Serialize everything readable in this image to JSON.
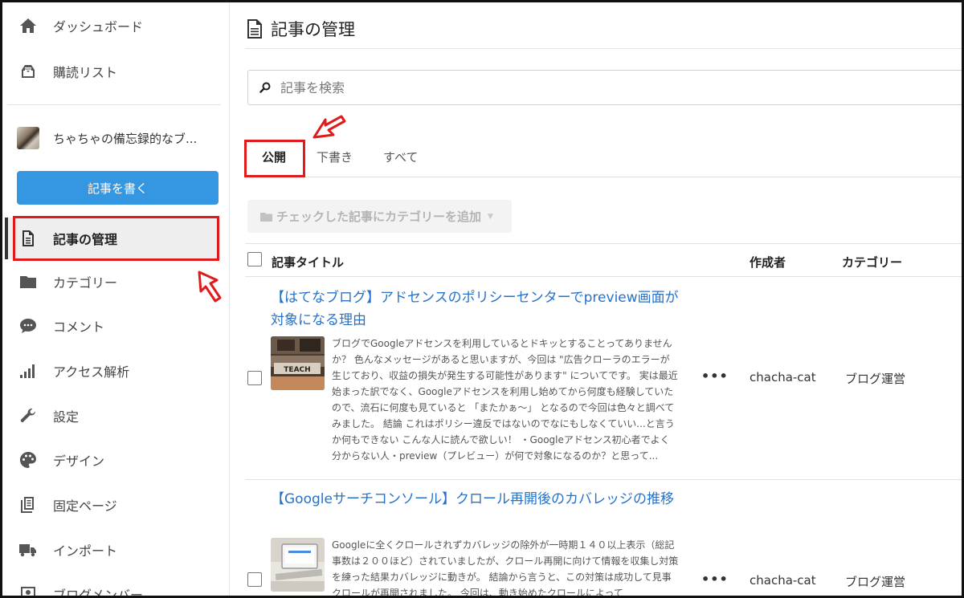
{
  "sidebar": {
    "items": [
      {
        "label": "ダッシュボード",
        "icon": "home-icon"
      },
      {
        "label": "購読リスト",
        "icon": "inbox-icon"
      },
      {
        "label": "記事の管理",
        "icon": "document-icon"
      },
      {
        "label": "カテゴリー",
        "icon": "folder-icon"
      },
      {
        "label": "コメント",
        "icon": "comment-icon"
      },
      {
        "label": "アクセス解析",
        "icon": "signal-bars-icon"
      },
      {
        "label": "設定",
        "icon": "wrench-icon"
      },
      {
        "label": "デザイン",
        "icon": "palette-icon"
      },
      {
        "label": "固定ページ",
        "icon": "pages-icon"
      },
      {
        "label": "インポート",
        "icon": "truck-icon"
      },
      {
        "label": "ブログメンバー",
        "icon": "member-icon"
      }
    ],
    "blog_name": "ちゃちゃの備忘録的なブ...",
    "write_button": "記事を書く"
  },
  "main": {
    "title": "記事の管理",
    "search_placeholder": "記事を検索",
    "tabs": [
      "公開",
      "下書き",
      "すべて"
    ],
    "category_button": "チェックした記事にカテゴリーを追加",
    "table": {
      "headers": {
        "title": "記事タイトル",
        "author": "作成者",
        "category": "カテゴリー"
      },
      "rows": [
        {
          "title": "【はてなブログ】アドセンスのポリシーセンターでpreview画面が対象になる理由",
          "excerpt": "ブログでGoogleアドセンスを利用しているとドキッとすることってありませんか？ 色んなメッセージがあると思いますが、今回は \"広告クローラのエラーが生じており、収益の損失が発生する可能性があります\" についてです。 実は最近始まった訳でなく、Googleアドセンスを利用し始めてから何度も経験していたので、流石に何度も見ていると 「またかぁ〜」 となるので今回は色々と調べてみました。 結論 これはポリシー違反ではないのでなにもしなくていい...と言うか何もできない こんな人に読んで欲しい！ ・Googleアドセンス初心者でよく分からない人・preview（プレビュー）が何で対象になるのか？と思って...",
          "thumb_text": "TEACH",
          "more": "•••",
          "author": "chacha-cat",
          "category": "ブログ運営"
        },
        {
          "title": "【Googleサーチコンソール】クロール再開後のカバレッジの推移",
          "excerpt": "Googleに全くクロールされずカバレッジの除外が一時期１４０以上表示（総記事数は２００ほど）されていましたが、クロール再開に向けて情報を収集し対策を練った結果カバレッジに動きが。 結論から言うと、この対策は成功して見事クロールが再開されました。 今回は、動き始めたクロールによって",
          "more": "•••",
          "author": "chacha-cat",
          "category": "ブログ運営"
        }
      ]
    }
  },
  "colors": {
    "accent": "#3596e2",
    "link": "#2672c9",
    "annotation": "#e01b1b"
  }
}
